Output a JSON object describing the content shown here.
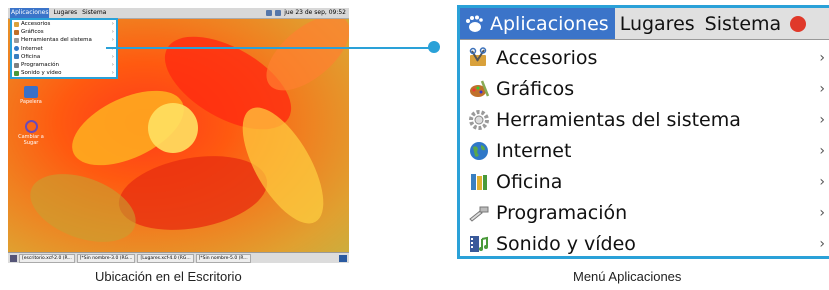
{
  "desktop": {
    "topbar": {
      "menus": [
        "Aplicaciones",
        "Lugares",
        "Sistema"
      ],
      "datetime": "jue 23 de sep, 09:52"
    },
    "icons": [
      {
        "label": "Papelera",
        "icon": "trash-icon"
      },
      {
        "label": "Cambiar a Sugar",
        "icon": "sugar-icon"
      }
    ],
    "taskbar": [
      "[escritorio.xcf-2.0 (R...",
      "[*Sin nombre-3.0 (RG...",
      "[Lugares.xcf-4.0 (RG...",
      "[*Sin nombre-5.0 (R..."
    ]
  },
  "menu": {
    "bar": [
      "Aplicaciones",
      "Lugares",
      "Sistema"
    ],
    "items": [
      {
        "label": "Accesorios",
        "icon": "accessories-icon",
        "color": "#d9a13b"
      },
      {
        "label": "Gráficos",
        "icon": "graphics-icon",
        "color": "#c0702a"
      },
      {
        "label": "Herramientas del sistema",
        "icon": "system-tools-icon",
        "color": "#9a9a9a"
      },
      {
        "label": "Internet",
        "icon": "internet-globe-icon",
        "color": "#2f78c8"
      },
      {
        "label": "Oficina",
        "icon": "office-icon",
        "color": "#3a7fc0"
      },
      {
        "label": "Programación",
        "icon": "programming-icon",
        "color": "#808080"
      },
      {
        "label": "Sonido y vídeo",
        "icon": "sound-video-icon",
        "color": "#4a9a3a"
      }
    ],
    "submenu_arrow": "›"
  },
  "captions": {
    "left": "Ubicación en el Escritorio",
    "right": "Menú Aplicaciones"
  },
  "colors": {
    "highlight": "#2aa1d8",
    "menu_active": "#3b74c9"
  }
}
